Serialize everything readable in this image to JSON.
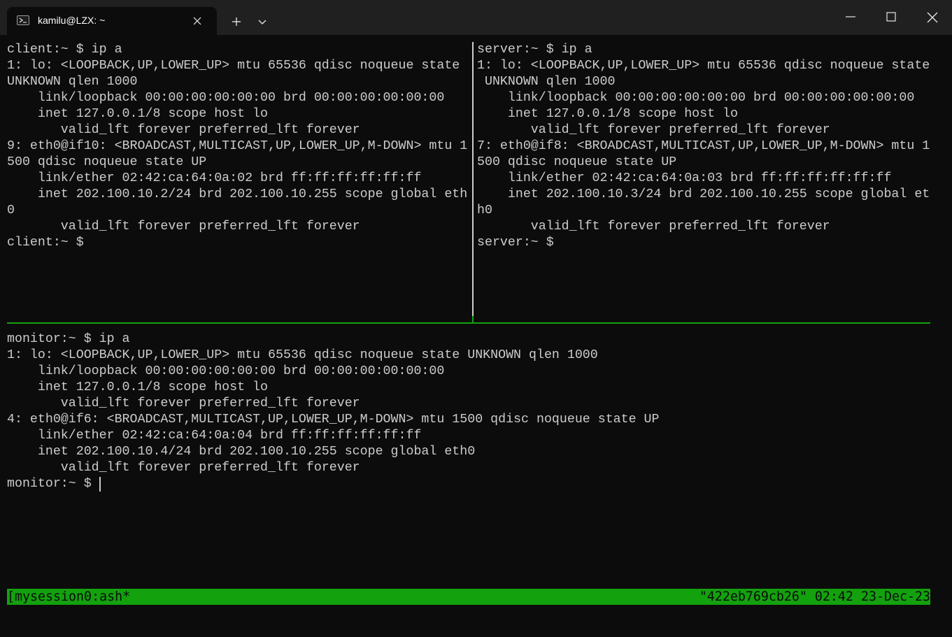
{
  "window": {
    "tab_title": "kamilu@LZX: ~",
    "icons": {
      "tab": "powershell-terminal-icon",
      "close_tab": "close-icon",
      "new_tab": "plus-icon",
      "dropdown": "chevron-down-icon",
      "minimize": "minimize-icon",
      "maximize": "maximize-icon",
      "close_window": "close-icon"
    }
  },
  "colors": {
    "background": "#0c0c0c",
    "titlebar": "#202020",
    "text": "#cccccc",
    "tmux_green": "#13a10e"
  },
  "panes": {
    "client": {
      "lines": [
        "client:~ $ ip a",
        "1: lo: <LOOPBACK,UP,LOWER_UP> mtu 65536 qdisc noqueue state",
        "UNKNOWN qlen 1000",
        "    link/loopback 00:00:00:00:00:00 brd 00:00:00:00:00:00",
        "    inet 127.0.0.1/8 scope host lo",
        "       valid_lft forever preferred_lft forever",
        "9: eth0@if10: <BROADCAST,MULTICAST,UP,LOWER_UP,M-DOWN> mtu 1",
        "500 qdisc noqueue state UP",
        "    link/ether 02:42:ca:64:0a:02 brd ff:ff:ff:ff:ff:ff",
        "    inet 202.100.10.2/24 brd 202.100.10.255 scope global eth",
        "0",
        "       valid_lft forever preferred_lft forever",
        "client:~ $"
      ]
    },
    "server": {
      "lines": [
        "server:~ $ ip a",
        "1: lo: <LOOPBACK,UP,LOWER_UP> mtu 65536 qdisc noqueue state",
        " UNKNOWN qlen 1000",
        "    link/loopback 00:00:00:00:00:00 brd 00:00:00:00:00:00",
        "    inet 127.0.0.1/8 scope host lo",
        "       valid_lft forever preferred_lft forever",
        "7: eth0@if8: <BROADCAST,MULTICAST,UP,LOWER_UP,M-DOWN> mtu 1",
        "500 qdisc noqueue state UP",
        "    link/ether 02:42:ca:64:0a:03 brd ff:ff:ff:ff:ff:ff",
        "    inet 202.100.10.3/24 brd 202.100.10.255 scope global et",
        "h0",
        "       valid_lft forever preferred_lft forever",
        "server:~ $"
      ]
    },
    "monitor": {
      "lines": [
        "monitor:~ $ ip a",
        "1: lo: <LOOPBACK,UP,LOWER_UP> mtu 65536 qdisc noqueue state UNKNOWN qlen 1000",
        "    link/loopback 00:00:00:00:00:00 brd 00:00:00:00:00:00",
        "    inet 127.0.0.1/8 scope host lo",
        "       valid_lft forever preferred_lft forever",
        "4: eth0@if6: <BROADCAST,MULTICAST,UP,LOWER_UP,M-DOWN> mtu 1500 qdisc noqueue state UP",
        "    link/ether 02:42:ca:64:0a:04 brd ff:ff:ff:ff:ff:ff",
        "    inet 202.100.10.4/24 brd 202.100.10.255 scope global eth0",
        "       valid_lft forever preferred_lft forever",
        "monitor:~ $"
      ]
    }
  },
  "statusbar": {
    "left": "[mysession0:ash*",
    "right": "\"422eb769cb26\" 02:42 23-Dec-23"
  }
}
